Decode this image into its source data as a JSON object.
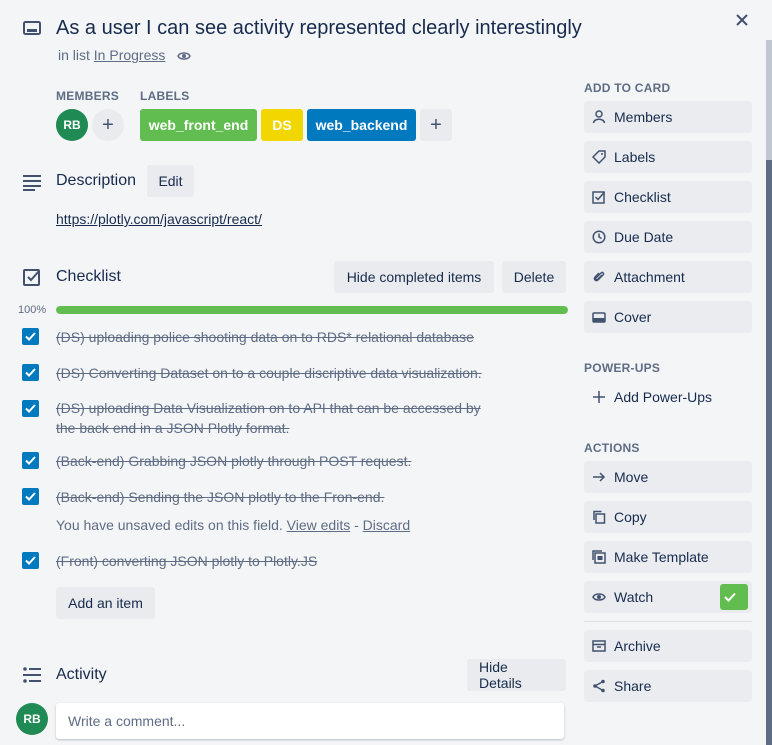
{
  "card": {
    "title": "As a user I can see activity represented clearly interestingly",
    "in_list_prefix": "in list",
    "list_name": "In Progress"
  },
  "members": {
    "heading": "MEMBERS",
    "initials": "RB"
  },
  "labels": {
    "heading": "LABELS",
    "items": [
      {
        "text": "web_front_end",
        "color": "#61bd4f"
      },
      {
        "text": "DS",
        "color": "#f2d600"
      },
      {
        "text": "web_backend",
        "color": "#0079bf"
      }
    ]
  },
  "description": {
    "heading": "Description",
    "edit_label": "Edit",
    "link": "https://plotly.com/javascript/react/"
  },
  "checklist": {
    "heading": "Checklist",
    "hide_label": "Hide completed items",
    "delete_label": "Delete",
    "progress_text": "100%",
    "progress_percent": 100,
    "items": [
      {
        "line1": "(DS) uploading police shooting data on to RDS* relational database",
        "line2": ""
      },
      {
        "line1": "(DS) Converting Dataset on to a couple discriptive data visualization.",
        "line2": ""
      },
      {
        "line1": "(DS) uploading Data Visualization on to API that can be accessed by",
        "line2": "the back end in a JSON Plotly format."
      },
      {
        "line1": "(Back-end) Grabbing JSON plotly through POST request.",
        "line2": ""
      },
      {
        "line1": "(Back-end) Sending the JSON plotly to the Fron-end.",
        "line2": ""
      },
      {
        "line1": "(Front) converting JSON plotly to Plotly.JS",
        "line2": ""
      }
    ],
    "unsaved_text": "You have unsaved edits on this field.",
    "view_edits": "View edits",
    "separator": "-",
    "discard": "Discard",
    "add_item": "Add an item"
  },
  "activity": {
    "heading": "Activity",
    "hide_details": "Hide Details",
    "comment_placeholder": "Write a comment...",
    "avatar_initials": "RB"
  },
  "sidebar": {
    "add_to_card": "ADD TO CARD",
    "add_buttons": [
      "Members",
      "Labels",
      "Checklist",
      "Due Date",
      "Attachment",
      "Cover"
    ],
    "power_ups": "POWER-UPS",
    "add_power_ups": "Add Power-Ups",
    "actions": "ACTIONS",
    "action_buttons": [
      "Move",
      "Copy",
      "Make Template",
      "Watch"
    ],
    "bottom_buttons": [
      "Archive",
      "Share"
    ]
  }
}
